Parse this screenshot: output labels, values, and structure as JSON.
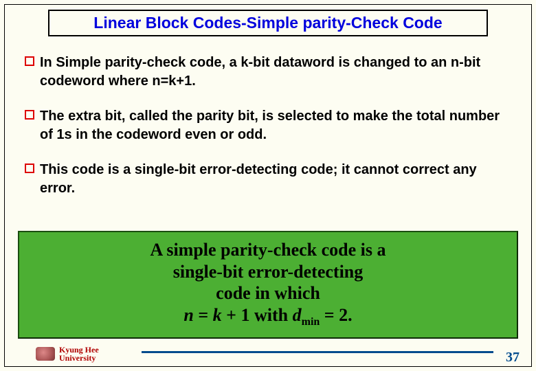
{
  "title": "Linear Block Codes-Simple parity-Check Code",
  "bullets": [
    "In Simple parity-check code, a k-bit dataword is changed to an n-bit codeword where n=k+1.",
    "The extra bit, called the parity bit, is selected to make the total number of 1s in the codeword even or odd.",
    "This code is a single-bit error-detecting code; it cannot correct any error."
  ],
  "callout": {
    "line1": "A simple parity-check code is a",
    "line2": "single-bit error-detecting",
    "line3": "code in which",
    "n": "n",
    "eq1": " = ",
    "k": "k",
    "eq2": " + 1 with ",
    "d": "d",
    "dsub": "min",
    "eq3": " = 2."
  },
  "footer": {
    "uni_line1": "Kyung Hee",
    "uni_line2": "University",
    "page": "37"
  }
}
